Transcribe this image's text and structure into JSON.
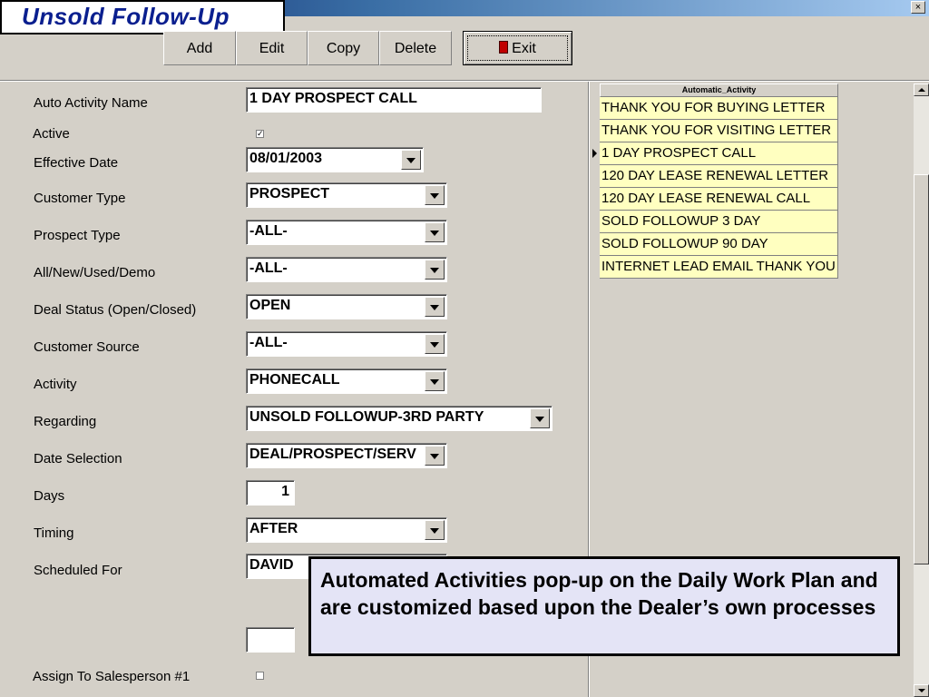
{
  "window": {
    "close_glyph": "×"
  },
  "slide": {
    "title": "Unsold Follow-Up"
  },
  "toolbar": {
    "add_label": "Add",
    "edit_label": "Edit",
    "copy_label": "Copy",
    "delete_label": "Delete",
    "exit_label": "Exit",
    "exit_icon": "door-icon"
  },
  "form": {
    "auto_activity_name": {
      "label": "Auto Activity Name",
      "value": "1 DAY PROSPECT CALL"
    },
    "active": {
      "label": "Active",
      "checked": true,
      "glyph": "✓"
    },
    "effective_date": {
      "label": "Effective Date",
      "value": "08/01/2003"
    },
    "customer_type": {
      "label": "Customer Type",
      "value": "PROSPECT"
    },
    "prospect_type": {
      "label": "Prospect Type",
      "value": "-ALL-"
    },
    "all_new_used_demo": {
      "label": "All/New/Used/Demo",
      "value": "-ALL-"
    },
    "deal_status": {
      "label": "Deal Status (Open/Closed)",
      "value": "OPEN"
    },
    "customer_source": {
      "label": "Customer Source",
      "value": "-ALL-"
    },
    "activity": {
      "label": "Activity",
      "value": "PHONECALL"
    },
    "regarding": {
      "label": "Regarding",
      "value": "UNSOLD FOLLOWUP-3RD PARTY"
    },
    "date_selection": {
      "label": "Date Selection",
      "value": "DEAL/PROSPECT/SERV"
    },
    "days": {
      "label": "Days",
      "value": "1"
    },
    "timing": {
      "label": "Timing",
      "value": "AFTER"
    },
    "scheduled_for": {
      "label": "Scheduled For",
      "value": "DAVID"
    },
    "extra_input": {
      "value": ""
    },
    "assign_to_salesperson_1": {
      "label": "Assign To Salesperson #1",
      "checked": false
    }
  },
  "grid": {
    "header": "Automatic_Activity",
    "selected_index": 2,
    "rows": [
      "THANK YOU FOR BUYING LETTER",
      "THANK YOU FOR VISITING LETTER",
      "1 DAY PROSPECT CALL",
      "120 DAY LEASE RENEWAL LETTER",
      "120 DAY LEASE RENEWAL CALL",
      "SOLD FOLLOWUP 3 DAY",
      "SOLD FOLLOWUP 90 DAY",
      "INTERNET LEAD EMAIL THANK YOU"
    ],
    "row_background": "#ffffc0"
  },
  "callout": {
    "text": "Automated Activities pop-up on the Daily Work Plan and are customized based upon the Dealer’s own processes"
  },
  "colors": {
    "title_text": "#0a1f8f",
    "window_bg": "#d4d0c8",
    "callout_bg": "#e4e4f6"
  }
}
